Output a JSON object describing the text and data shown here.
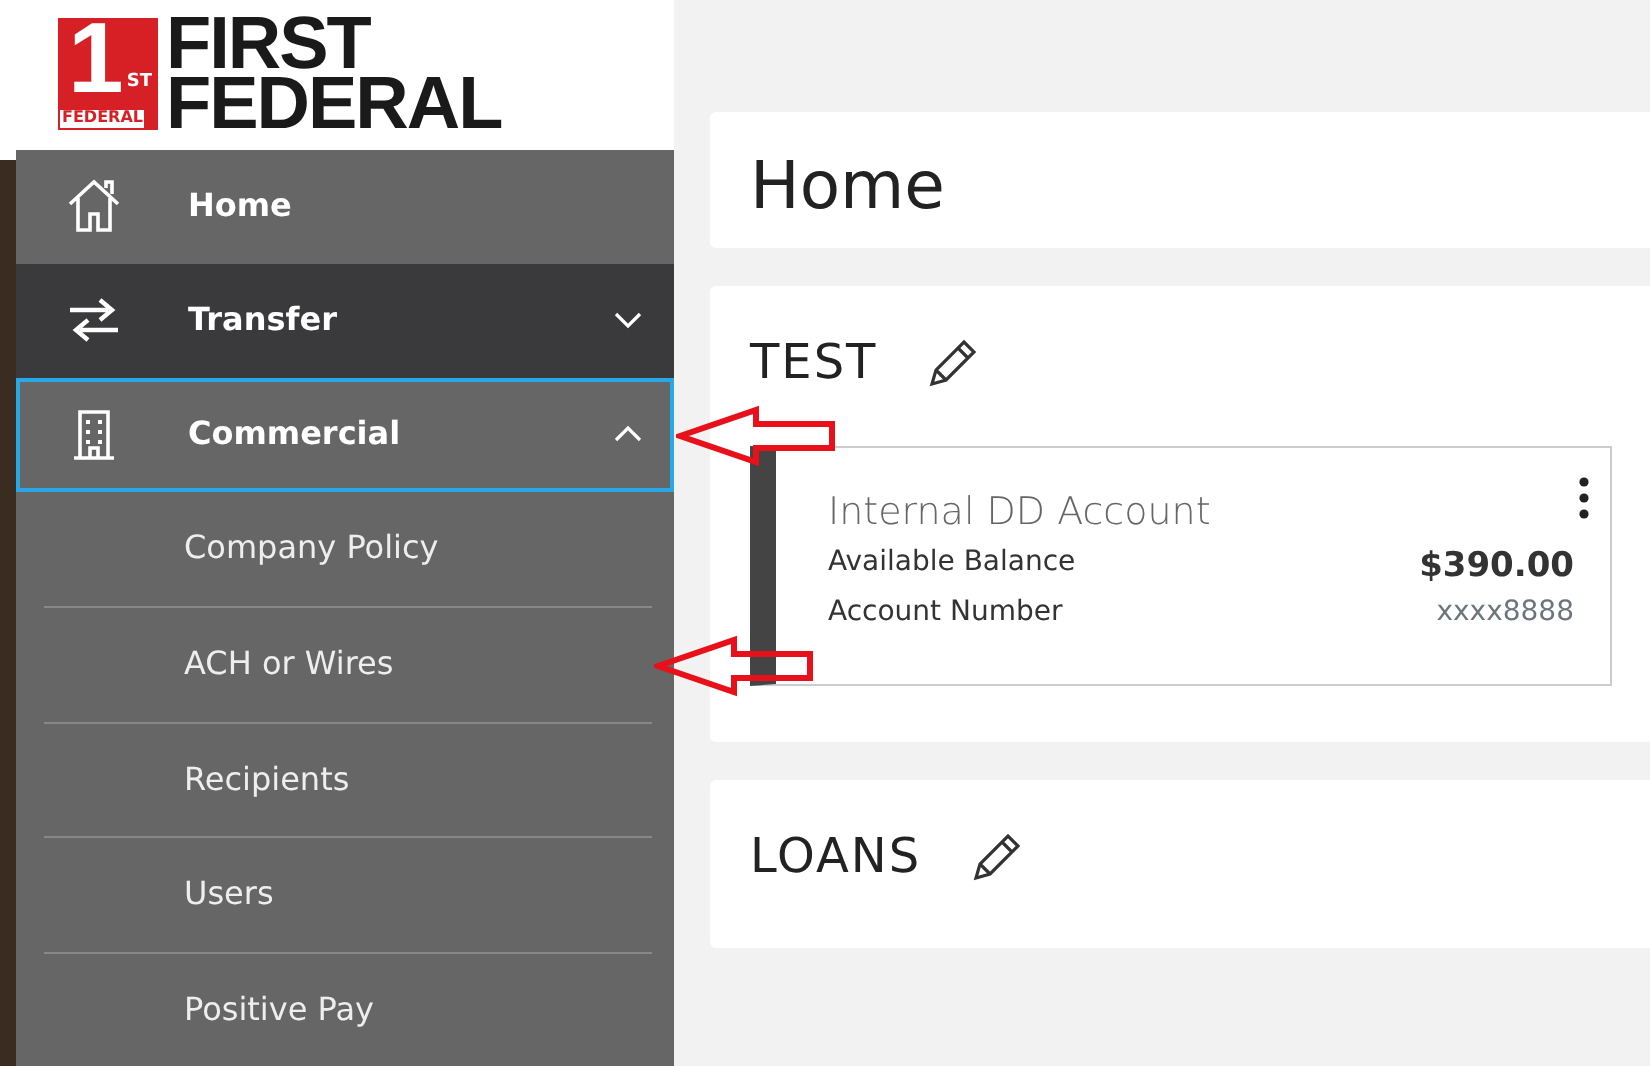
{
  "logo": {
    "badge_numeral": "1",
    "badge_superscript": "ST",
    "badge_word": "FEDERAL",
    "line_1": "FIRST",
    "line_2": "FEDERAL"
  },
  "sidebar": {
    "items": [
      {
        "label": "Home",
        "selected": false,
        "hovered": false
      },
      {
        "label": "Transfer",
        "selected": false,
        "hovered": true,
        "expanded": false
      },
      {
        "label": "Commercial",
        "selected": true,
        "hovered": false,
        "expanded": true,
        "children": [
          {
            "label": "Company Policy"
          },
          {
            "label": "ACH or Wires"
          },
          {
            "label": "Recipients"
          },
          {
            "label": "Users"
          },
          {
            "label": "Positive Pay"
          }
        ]
      }
    ]
  },
  "page_title": "Home",
  "groups": [
    {
      "title": "TEST",
      "accounts": [
        {
          "name": "Internal DD Account",
          "balance_label": "Available Balance",
          "balance": "$390.00",
          "number_label": "Account Number",
          "number": "xxxx8888"
        }
      ]
    },
    {
      "title": "LOANS"
    }
  ],
  "annotations": [
    {
      "kind": "arrow"
    },
    {
      "kind": "arrow"
    }
  ]
}
